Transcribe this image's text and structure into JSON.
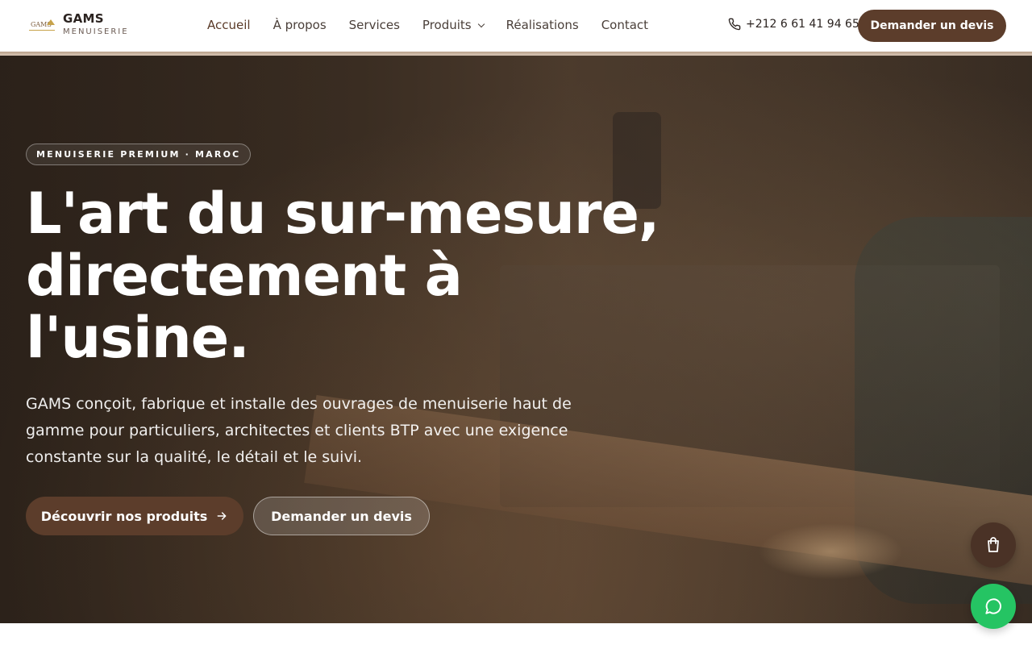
{
  "brand": {
    "logo_text": "GAMS",
    "title": "GAMS",
    "subtitle": "MENUISERIE"
  },
  "nav": {
    "items": [
      {
        "label": "Accueil"
      },
      {
        "label": "À propos"
      },
      {
        "label": "Services"
      },
      {
        "label": "Produits"
      },
      {
        "label": "Réalisations"
      },
      {
        "label": "Contact"
      }
    ]
  },
  "header": {
    "phone": "+212 6 61 41 94 65",
    "cta_label": "Demander un devis"
  },
  "hero": {
    "badge": "MENUISERIE PREMIUM · MAROC",
    "title_lines": [
      "L'art du sur-mesure,",
      "directement à",
      "l'usine."
    ],
    "text": "GAMS conçoit, fabrique et installe des ouvrages de menuiserie haut de gamme pour particuliers, architectes et clients BTP avec une exigence constante sur la qualité, le détail et le suivi.",
    "primary_label": "Découvrir nos produits",
    "secondary_label": "Demander un devis"
  },
  "icons": {
    "phone": "phone-icon",
    "chevron": "chevron-down-icon",
    "arrow": "arrow-right-icon",
    "cart": "shopping-bag-icon",
    "whatsapp": "whatsapp-icon"
  },
  "colors": {
    "accent": "#5c3d2b",
    "whatsapp": "#25c463"
  }
}
